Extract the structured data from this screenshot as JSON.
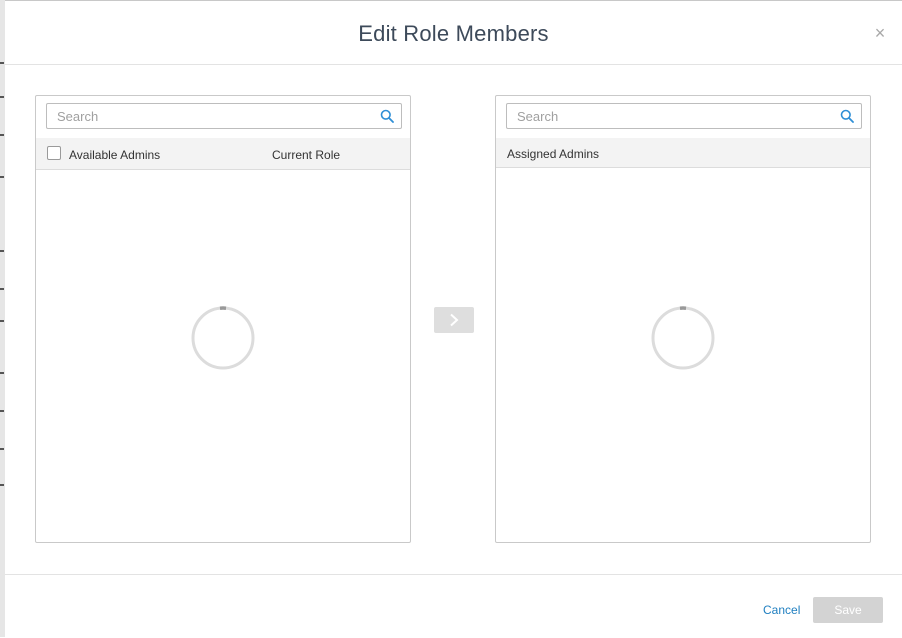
{
  "dialog": {
    "title": "Edit Role Members",
    "close_glyph": "×",
    "close_icon": "close-icon"
  },
  "available_panel": {
    "search_placeholder": "Search",
    "search_value": "",
    "search_icon": "search-icon",
    "select_all_checked": false,
    "columns": [
      "Available Admins",
      "Current Role"
    ],
    "rows": [],
    "loading": true
  },
  "transfer": {
    "glyph": ">",
    "icon": "chevron-right-icon",
    "enabled": false
  },
  "assigned_panel": {
    "search_placeholder": "Search",
    "search_value": "",
    "search_icon": "search-icon",
    "columns": [
      "Assigned Admins"
    ],
    "rows": [],
    "loading": true
  },
  "footer": {
    "cancel_label": "Cancel",
    "save_label": "Save",
    "save_enabled": false
  },
  "colors": {
    "title": "#3d4a5a",
    "link": "#1f7fc0",
    "disabled_button": "#d3d3d3",
    "search_icon": "#2f8fd6",
    "spinner_track": "#dcdcdc",
    "spinner_head": "#999999"
  }
}
